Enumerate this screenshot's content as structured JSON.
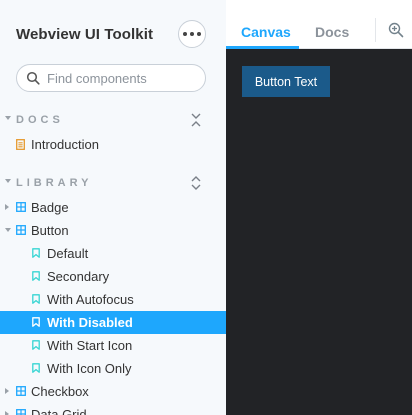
{
  "sidebar": {
    "title": "Webview UI Toolkit",
    "more_icon": "more-horizontal-icon",
    "search": {
      "placeholder": "Find components",
      "value": ""
    },
    "docs_section": {
      "label": "DOCS",
      "toggle_icon": "collapse-icon",
      "items": [
        {
          "label": "Introduction",
          "icon": "document-icon"
        }
      ]
    },
    "library_section": {
      "label": "LIBRARY",
      "toggle_icon": "expand-icon",
      "items": [
        {
          "label": "Badge",
          "icon": "component-icon",
          "expanded": false
        },
        {
          "label": "Button",
          "icon": "component-icon",
          "expanded": true,
          "stories": [
            {
              "label": "Default",
              "selected": false
            },
            {
              "label": "Secondary",
              "selected": false
            },
            {
              "label": "With Autofocus",
              "selected": false
            },
            {
              "label": "With Disabled",
              "selected": true
            },
            {
              "label": "With Start Icon",
              "selected": false
            },
            {
              "label": "With Icon Only",
              "selected": false
            }
          ]
        },
        {
          "label": "Checkbox",
          "icon": "component-icon",
          "expanded": false
        },
        {
          "label": "Data Grid",
          "icon": "component-icon",
          "expanded": false
        }
      ]
    }
  },
  "tabs": [
    {
      "label": "Canvas",
      "active": true
    },
    {
      "label": "Docs",
      "active": false
    }
  ],
  "toolbar": {
    "zoom_icon": "zoom-in-icon"
  },
  "canvas": {
    "demo_button_label": "Button Text"
  },
  "colors": {
    "accent": "#1ea7fd",
    "canvas_bg": "#222326",
    "demo_button": "#1b5a8a",
    "doc_icon": "#e69a2e",
    "story_icon": "#37d5d3",
    "component_icon": "#1ea7fd"
  }
}
